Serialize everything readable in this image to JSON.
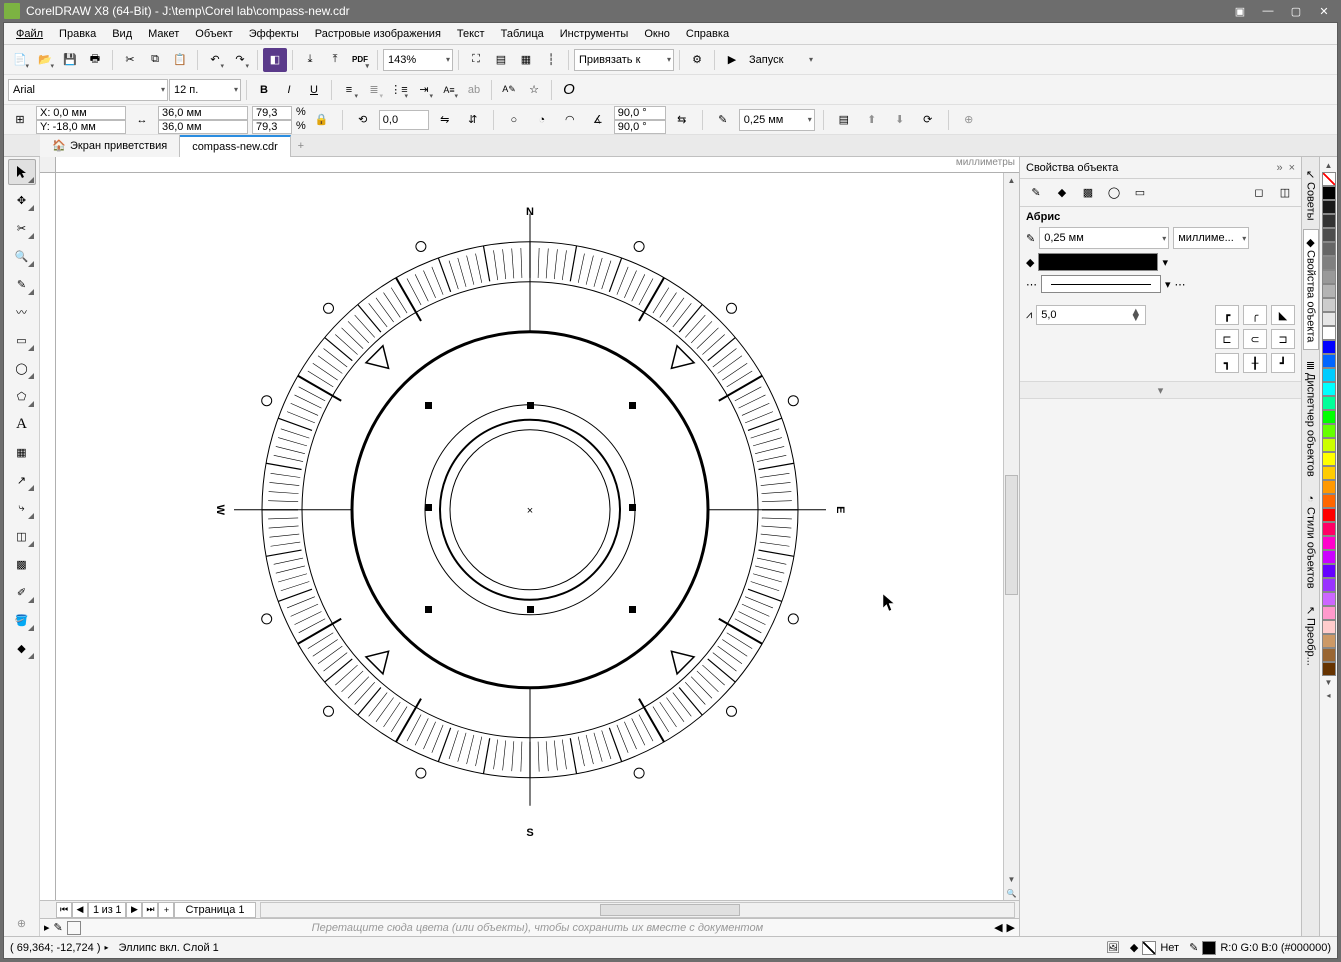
{
  "titlebar": {
    "text": "CorelDRAW X8 (64-Bit) - J:\\temp\\Corel lab\\compass-new.cdr"
  },
  "menu": [
    "Файл",
    "Правка",
    "Вид",
    "Макет",
    "Объект",
    "Эффекты",
    "Растровые изображения",
    "Текст",
    "Таблица",
    "Инструменты",
    "Окно",
    "Справка"
  ],
  "toolbar1": {
    "zoom": "143%",
    "snap": "Привязать к",
    "launch": "Запуск"
  },
  "textbar": {
    "font": "Arial",
    "size": "12 п."
  },
  "propbar": {
    "x_label": "X:",
    "x": "0,0 мм",
    "y_label": "Y:",
    "y": "-18,0 мм",
    "w": "36,0 мм",
    "h": "36,0 мм",
    "sx": "79,3",
    "sy": "79,3",
    "pct": "%",
    "rot": "0,0",
    "ang1": "90,0 °",
    "ang2": "90,0 °",
    "outline": "0,25 мм"
  },
  "doctabs": {
    "welcome": "Экран приветствия",
    "doc": "compass-new.cdr"
  },
  "ruler": {
    "units": "миллиметры"
  },
  "compass": {
    "N": "N",
    "S": "S",
    "E": "E",
    "W": "W"
  },
  "docker": {
    "title": "Свойства объекта",
    "section": "Абрис",
    "width": "0,25 мм",
    "units": "миллиме...",
    "miter": "5,0"
  },
  "docktabs": [
    "Советы",
    "Свойства объекта",
    "Диспетчер объектов",
    "Стили объектов",
    "Преобр..."
  ],
  "page": {
    "num": "1",
    "of_word": "из",
    "total": "1",
    "tab": "Страница 1"
  },
  "palette_hint": "Перетащите сюда цвета (или объекты), чтобы сохранить их вместе с документом",
  "status": {
    "coords": "( 69,364; -12,724 )",
    "obj": "Эллипс вкл. Слой 1",
    "fill_none": "Нет",
    "color_desc": "R:0 G:0 B:0 (#000000)"
  },
  "palette_colors": [
    "#000000",
    "#1a1a1a",
    "#333333",
    "#4d4d4d",
    "#666666",
    "#808080",
    "#999999",
    "#b3b3b3",
    "#cccccc",
    "#e6e6e6",
    "#ffffff",
    "#0000ff",
    "#0066ff",
    "#00ccff",
    "#00ffff",
    "#00ff99",
    "#00ff00",
    "#66ff00",
    "#ccff00",
    "#ffff00",
    "#ffcc00",
    "#ff9900",
    "#ff6600",
    "#ff0000",
    "#ff0066",
    "#ff00cc",
    "#cc00ff",
    "#6600ff",
    "#9933ff",
    "#cc66ff",
    "#ff99cc",
    "#ffcccc",
    "#cc9966",
    "#996633",
    "#663300"
  ]
}
